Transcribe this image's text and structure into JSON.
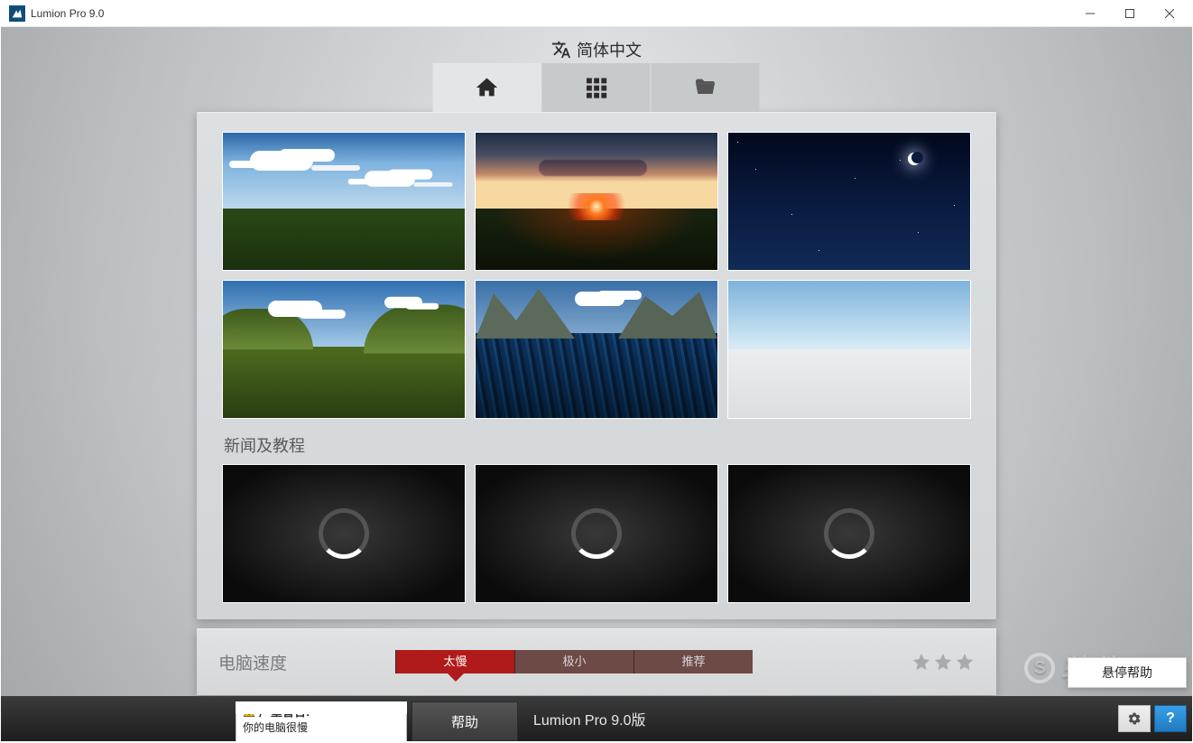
{
  "window": {
    "title": "Lumion Pro 9.0"
  },
  "language": {
    "label": "简体中文"
  },
  "tabs": {
    "home": "home",
    "grid": "grid",
    "folder": "folder"
  },
  "scenes": [
    {
      "id": "plain-day"
    },
    {
      "id": "plain-sunset"
    },
    {
      "id": "plain-night"
    },
    {
      "id": "hills-day"
    },
    {
      "id": "mountain-water"
    },
    {
      "id": "empty-white"
    }
  ],
  "section": {
    "news_title": "新闻及教程"
  },
  "speed": {
    "label": "电脑速度",
    "options": [
      "太慢",
      "极小",
      "推荐"
    ],
    "selected": 0
  },
  "warning": {
    "title": "严重警告!",
    "sub": "你的电脑很慢"
  },
  "help_button": "帮助",
  "version": "Lumion Pro 9.0版",
  "hover_help": "悬停帮助",
  "watermark": "软件SOS",
  "q_label": "?"
}
